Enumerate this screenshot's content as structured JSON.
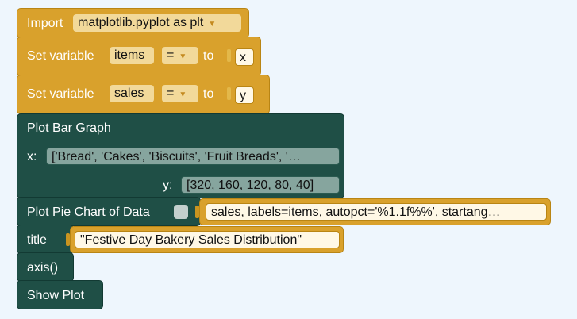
{
  "blocks": {
    "import": {
      "label": "Import",
      "module": "matplotlib.pyplot as plt"
    },
    "set_items": {
      "label": "Set variable",
      "var": "items",
      "op": "=",
      "to": "to",
      "value": "x"
    },
    "set_sales": {
      "label": "Set variable",
      "var": "sales",
      "op": "=",
      "to": "to",
      "value": "y"
    },
    "bar": {
      "label": "Plot Bar Graph",
      "x_label": "x:",
      "x_value": "['Bread', 'Cakes', 'Biscuits', 'Fruit Breads', '…",
      "y_label": "y:",
      "y_value": "[320, 160, 120, 80, 40]"
    },
    "pie": {
      "label": "Plot Pie Chart of Data",
      "args": "sales, labels=items, autopct='%1.1f%%', startang…"
    },
    "title": {
      "label": "title",
      "value": "\"Festive Day Bakery Sales Distribution\""
    },
    "axis": {
      "label": "axis()"
    },
    "show": {
      "label": "Show Plot"
    }
  },
  "colors": {
    "statement_gold": "#d9a12c",
    "statement_teal": "#1f4f46",
    "field_gray": "#86a59e",
    "workspace_bg": "#eef6fd"
  }
}
